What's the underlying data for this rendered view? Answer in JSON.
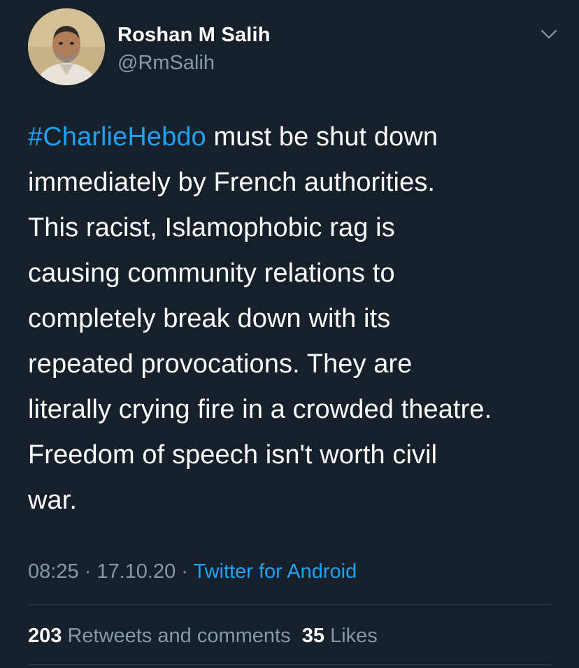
{
  "user": {
    "display_name": "Roshan M Salih",
    "handle": "@RmSalih",
    "avatar_icon": "user-avatar"
  },
  "menu": {
    "icon": "chevron-down-icon"
  },
  "tweet": {
    "hashtag": "#CharlieHebdo",
    "lines": [
      " must be shut down",
      "immediately by French authorities.",
      "This racist, Islamophobic rag is",
      "causing community relations to",
      "completely break down with its",
      "repeated provocations. They are",
      "literally crying fire in a crowded theatre.",
      "Freedom of speech isn't worth civil",
      "war."
    ]
  },
  "meta": {
    "time": "08:25",
    "separator": " · ",
    "date": "17.10.20",
    "source": "Twitter for Android"
  },
  "stats": {
    "retweets_count": "203",
    "retweets_label": "Retweets and comments",
    "likes_count": "35",
    "likes_label": "Likes"
  },
  "colors": {
    "background": "#15202b",
    "link": "#1da1f2",
    "secondary_text": "#8899a6",
    "divider": "#38444d"
  }
}
